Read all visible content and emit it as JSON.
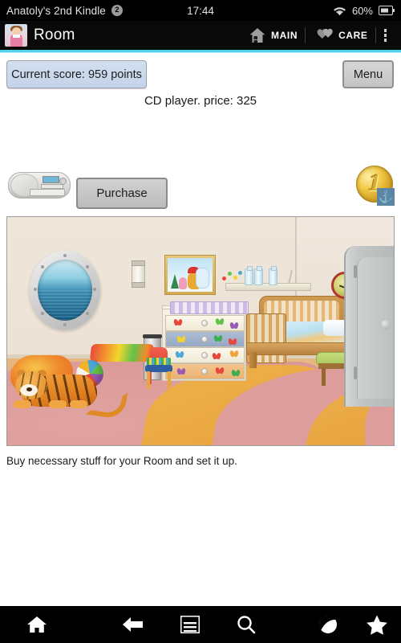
{
  "status_bar": {
    "device_name": "Anatoly's 2nd Kindle",
    "notification_count": "2",
    "time": "17:44",
    "battery_percent": "60%",
    "wifi_icon": "wifi-icon",
    "battery_icon": "battery-icon"
  },
  "app_header": {
    "title": "Room",
    "avatar_icon": "avatar-girl-icon",
    "actions": [
      {
        "label": "MAIN",
        "icon": "house-icon"
      },
      {
        "label": "CARE",
        "icon": "hearts-icon"
      }
    ],
    "overflow_icon": "overflow-menu-icon"
  },
  "toolbar": {
    "score_label": "Current score: 959 points",
    "menu_label": "Menu"
  },
  "item": {
    "title": "CD player. price: 325",
    "thumbnail_icon": "cd-player-icon",
    "purchase_label": "Purchase",
    "currency_icon": "gold-coin-icon",
    "currency_value": "1",
    "currency_badge_icon": "anchor-icon"
  },
  "room_scene": {
    "alt": "child's cabin room with crib, dresser, toys and porthole window",
    "objects": [
      "porthole-window",
      "wall-sconce",
      "winnie-the-pooh-picture",
      "wall-shelf",
      "baby-bottles",
      "butterfly-dresser",
      "trash-bin",
      "wooden-crib",
      "green-bench",
      "wall-clock",
      "door",
      "rainbow-table",
      "red-chair",
      "beach-ball",
      "beanbag",
      "plush-tiger",
      "swirl-carpet"
    ]
  },
  "caption": "Buy necessary stuff for your Room and set it up.",
  "bottom_nav": [
    {
      "icon": "home-icon"
    },
    {
      "icon": "back-arrow-icon"
    },
    {
      "icon": "menu-icon"
    },
    {
      "icon": "search-icon"
    },
    {
      "icon": "browser-globe-icon"
    },
    {
      "icon": "star-icon"
    }
  ],
  "colors": {
    "accent_teal": "#4fd3e8",
    "score_button": "#c9d8ec",
    "bar_black": "#000000"
  }
}
